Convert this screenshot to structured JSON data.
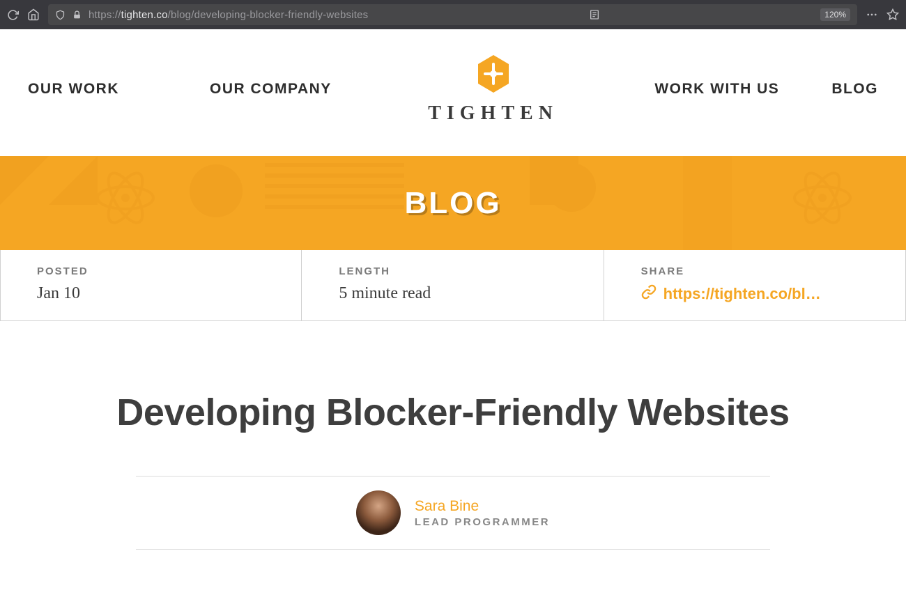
{
  "browser": {
    "url_prefix": "https://",
    "url_domain": "tighten.co",
    "url_path": "/blog/developing-blocker-friendly-websites",
    "zoom": "120%"
  },
  "nav": {
    "our_work": "OUR WORK",
    "our_company": "OUR COMPANY",
    "work_with_us": "WORK WITH US",
    "blog": "BLOG"
  },
  "brand": {
    "wordmark": "TIGHTEN"
  },
  "hero": {
    "title": "BLOG"
  },
  "meta": {
    "posted_label": "POSTED",
    "posted_value": "Jan 10",
    "length_label": "LENGTH",
    "length_value": "5 minute read",
    "share_label": "SHARE",
    "share_url": "https://tighten.co/bl…"
  },
  "article": {
    "title": "Developing Blocker-Friendly Websites"
  },
  "author": {
    "name": "Sara Bine",
    "role": "LEAD PROGRAMMER"
  },
  "colors": {
    "accent": "#f5a623",
    "text_dark": "#3a3a3a",
    "text_muted": "#7a7a7a"
  }
}
